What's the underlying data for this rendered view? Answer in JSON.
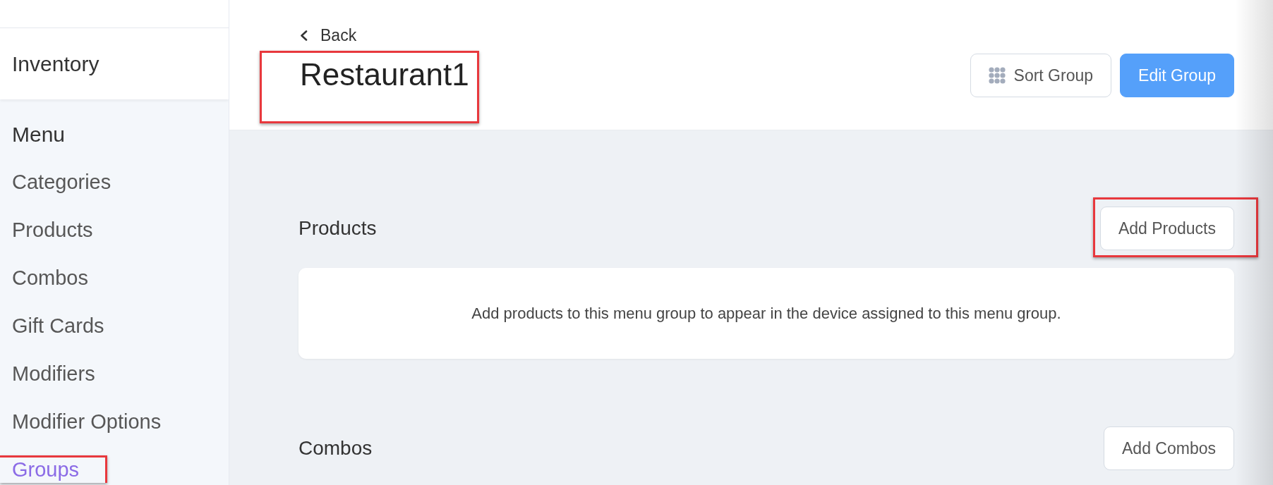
{
  "sidebar": {
    "top_item": "Inventory",
    "menu": {
      "title": "Menu",
      "items": [
        {
          "label": "Categories",
          "selected": false,
          "highlighted": false
        },
        {
          "label": "Products",
          "selected": false,
          "highlighted": false
        },
        {
          "label": "Combos",
          "selected": false,
          "highlighted": false
        },
        {
          "label": "Gift Cards",
          "selected": false,
          "highlighted": false
        },
        {
          "label": "Modifiers",
          "selected": false,
          "highlighted": false
        },
        {
          "label": "Modifier Options",
          "selected": false,
          "highlighted": false
        },
        {
          "label": "Groups",
          "selected": true,
          "highlighted": true
        }
      ]
    }
  },
  "header": {
    "back_link": "Back",
    "title": {
      "text": "Restaurant1",
      "highlighted": true
    },
    "buttons": [
      {
        "label": "Sort Group",
        "kind": "outline"
      },
      {
        "label": "Edit Group",
        "kind": "primary"
      }
    ]
  },
  "sections": [
    {
      "title": "Products",
      "button": {
        "label": "Add Products",
        "highlighted": true
      },
      "empty_message": "Add products to this menu group to appear in the device assigned to this menu group."
    },
    {
      "title": "Combos",
      "button": {
        "label": "Add Combos",
        "highlighted": false
      }
    }
  ]
}
